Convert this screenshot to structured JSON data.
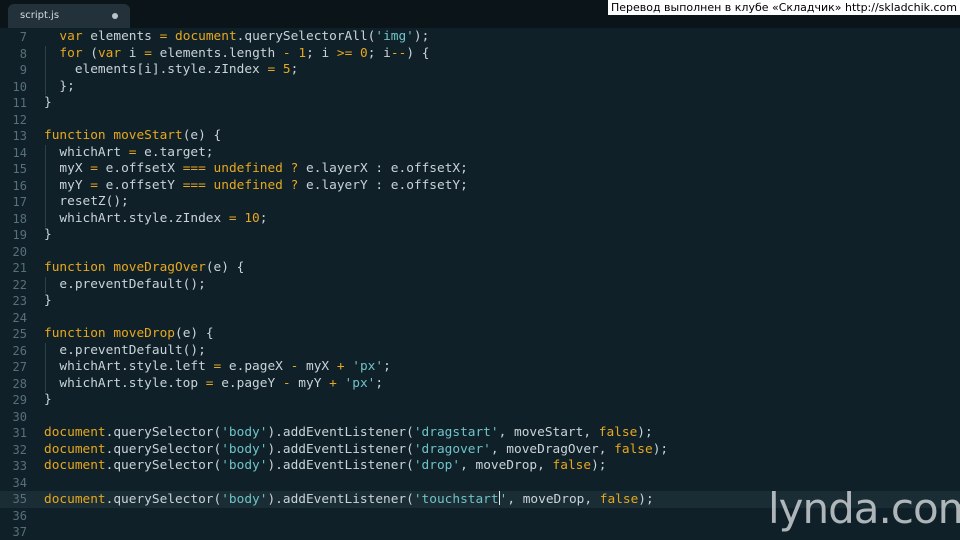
{
  "tab": {
    "title": "script.js",
    "modified_indicator": "●"
  },
  "watermark": "Перевод выполнен в клубе «Складчик» http://skladchik.com",
  "logo": "lynda.com",
  "editor": {
    "current_line": 35,
    "lines": [
      {
        "num": "7",
        "tokens": [
          [
            "pl",
            "  "
          ],
          [
            "kw",
            "var"
          ],
          [
            "pl",
            " elements "
          ],
          [
            "op",
            "="
          ],
          [
            "pl",
            " "
          ],
          [
            "fn",
            "document"
          ],
          [
            "pl",
            ".querySelectorAll("
          ],
          [
            "st",
            "'img'"
          ],
          [
            "pl",
            ");"
          ]
        ]
      },
      {
        "num": "8",
        "tokens": [
          [
            "pl",
            "  "
          ],
          [
            "kw",
            "for"
          ],
          [
            "pl",
            " ("
          ],
          [
            "kw",
            "var"
          ],
          [
            "pl",
            " i "
          ],
          [
            "op",
            "="
          ],
          [
            "pl",
            " elements.length "
          ],
          [
            "op",
            "-"
          ],
          [
            "pl",
            " "
          ],
          [
            "nm",
            "1"
          ],
          [
            "pl",
            "; i "
          ],
          [
            "op",
            ">="
          ],
          [
            "pl",
            " "
          ],
          [
            "nm",
            "0"
          ],
          [
            "pl",
            "; i"
          ],
          [
            "op",
            "--"
          ],
          [
            "pl",
            ") {"
          ]
        ]
      },
      {
        "num": "9",
        "tokens": [
          [
            "pl",
            "    elements[i].style.zIndex "
          ],
          [
            "op",
            "="
          ],
          [
            "pl",
            " "
          ],
          [
            "nm",
            "5"
          ],
          [
            "pl",
            ";"
          ]
        ]
      },
      {
        "num": "10",
        "tokens": [
          [
            "pl",
            "  };"
          ]
        ]
      },
      {
        "num": "11",
        "tokens": [
          [
            "pl",
            "}"
          ]
        ]
      },
      {
        "num": "12",
        "tokens": []
      },
      {
        "num": "13",
        "tokens": [
          [
            "kw",
            "function"
          ],
          [
            "pl",
            " "
          ],
          [
            "fn",
            "moveStart"
          ],
          [
            "pl",
            "(e) {"
          ]
        ]
      },
      {
        "num": "14",
        "tokens": [
          [
            "pl",
            "  whichArt "
          ],
          [
            "op",
            "="
          ],
          [
            "pl",
            " e.target;"
          ]
        ]
      },
      {
        "num": "15",
        "tokens": [
          [
            "pl",
            "  myX "
          ],
          [
            "op",
            "="
          ],
          [
            "pl",
            " e.offsetX "
          ],
          [
            "op",
            "==="
          ],
          [
            "pl",
            " "
          ],
          [
            "kw",
            "undefined"
          ],
          [
            "pl",
            " "
          ],
          [
            "op",
            "?"
          ],
          [
            "pl",
            " e.layerX : e.offsetX;"
          ]
        ]
      },
      {
        "num": "16",
        "tokens": [
          [
            "pl",
            "  myY "
          ],
          [
            "op",
            "="
          ],
          [
            "pl",
            " e.offsetY "
          ],
          [
            "op",
            "==="
          ],
          [
            "pl",
            " "
          ],
          [
            "kw",
            "undefined"
          ],
          [
            "pl",
            " "
          ],
          [
            "op",
            "?"
          ],
          [
            "pl",
            " e.layerY : e.offsetY;"
          ]
        ]
      },
      {
        "num": "17",
        "tokens": [
          [
            "pl",
            "  resetZ();"
          ]
        ]
      },
      {
        "num": "18",
        "tokens": [
          [
            "pl",
            "  whichArt.style.zIndex "
          ],
          [
            "op",
            "="
          ],
          [
            "pl",
            " "
          ],
          [
            "nm",
            "10"
          ],
          [
            "pl",
            ";"
          ]
        ]
      },
      {
        "num": "19",
        "tokens": [
          [
            "pl",
            "}"
          ]
        ]
      },
      {
        "num": "20",
        "tokens": []
      },
      {
        "num": "21",
        "tokens": [
          [
            "kw",
            "function"
          ],
          [
            "pl",
            " "
          ],
          [
            "fn",
            "moveDragOver"
          ],
          [
            "pl",
            "(e) {"
          ]
        ]
      },
      {
        "num": "22",
        "tokens": [
          [
            "pl",
            "  e.preventDefault();"
          ]
        ]
      },
      {
        "num": "23",
        "tokens": [
          [
            "pl",
            "}"
          ]
        ]
      },
      {
        "num": "24",
        "tokens": []
      },
      {
        "num": "25",
        "tokens": [
          [
            "kw",
            "function"
          ],
          [
            "pl",
            " "
          ],
          [
            "fn",
            "moveDrop"
          ],
          [
            "pl",
            "(e) {"
          ]
        ]
      },
      {
        "num": "26",
        "tokens": [
          [
            "pl",
            "  e.preventDefault();"
          ]
        ]
      },
      {
        "num": "27",
        "tokens": [
          [
            "pl",
            "  whichArt.style.left "
          ],
          [
            "op",
            "="
          ],
          [
            "pl",
            " e.pageX "
          ],
          [
            "op",
            "-"
          ],
          [
            "pl",
            " myX "
          ],
          [
            "op",
            "+"
          ],
          [
            "pl",
            " "
          ],
          [
            "st",
            "'px'"
          ],
          [
            "pl",
            ";"
          ]
        ]
      },
      {
        "num": "28",
        "tokens": [
          [
            "pl",
            "  whichArt.style.top "
          ],
          [
            "op",
            "="
          ],
          [
            "pl",
            " e.pageY "
          ],
          [
            "op",
            "-"
          ],
          [
            "pl",
            " myY "
          ],
          [
            "op",
            "+"
          ],
          [
            "pl",
            " "
          ],
          [
            "st",
            "'px'"
          ],
          [
            "pl",
            ";"
          ]
        ]
      },
      {
        "num": "29",
        "tokens": [
          [
            "pl",
            "}"
          ]
        ]
      },
      {
        "num": "30",
        "tokens": []
      },
      {
        "num": "31",
        "tokens": [
          [
            "fn",
            "document"
          ],
          [
            "pl",
            ".querySelector("
          ],
          [
            "st",
            "'body'"
          ],
          [
            "pl",
            ").addEventListener("
          ],
          [
            "st",
            "'dragstart'"
          ],
          [
            "pl",
            ", moveStart, "
          ],
          [
            "kw",
            "false"
          ],
          [
            "pl",
            ");"
          ]
        ]
      },
      {
        "num": "32",
        "tokens": [
          [
            "fn",
            "document"
          ],
          [
            "pl",
            ".querySelector("
          ],
          [
            "st",
            "'body'"
          ],
          [
            "pl",
            ").addEventListener("
          ],
          [
            "st",
            "'dragover'"
          ],
          [
            "pl",
            ", moveDragOver, "
          ],
          [
            "kw",
            "false"
          ],
          [
            "pl",
            ");"
          ]
        ]
      },
      {
        "num": "33",
        "tokens": [
          [
            "fn",
            "document"
          ],
          [
            "pl",
            ".querySelector("
          ],
          [
            "st",
            "'body'"
          ],
          [
            "pl",
            ").addEventListener("
          ],
          [
            "st",
            "'drop'"
          ],
          [
            "pl",
            ", moveDrop, "
          ],
          [
            "kw",
            "false"
          ],
          [
            "pl",
            ");"
          ]
        ]
      },
      {
        "num": "34",
        "tokens": []
      },
      {
        "num": "35",
        "tokens": [
          [
            "fn",
            "document"
          ],
          [
            "pl",
            ".querySelector("
          ],
          [
            "st",
            "'body'"
          ],
          [
            "pl",
            ").addEventListener("
          ],
          [
            "st",
            "'touchstart"
          ],
          [
            "cursor",
            ""
          ],
          [
            "st",
            "'"
          ],
          [
            "pl",
            ", moveDrop, "
          ],
          [
            "kw",
            "false"
          ],
          [
            "pl",
            ");"
          ]
        ]
      },
      {
        "num": "36",
        "tokens": []
      },
      {
        "num": "37",
        "tokens": []
      }
    ]
  }
}
